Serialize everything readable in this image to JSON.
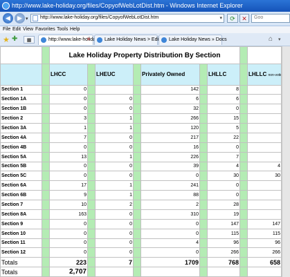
{
  "window": {
    "title": "http://www.lake-holiday.org/files/CopyofWebLotDist.htm - Windows Internet Explorer"
  },
  "address": {
    "url": "http://www.lake-holiday.org/files/CopyofWebLotDist.htm",
    "search_placeholder": "Goo"
  },
  "menu": {
    "items": [
      "File",
      "Edit",
      "View",
      "Favorites",
      "Tools",
      "Help"
    ]
  },
  "tabs": [
    {
      "label": "http://www.lake-holiday...",
      "active": true
    },
    {
      "label": "Lake Holiday News > Edit — ...",
      "active": false
    },
    {
      "label": "Lake Holiday News » Docs",
      "active": false
    }
  ],
  "sheet": {
    "title": "Lake Holiday Property Distribution By Section",
    "headers": {
      "lhcc": "LHCC",
      "lheuc": "LHEUC",
      "private": "Privately Owned",
      "lhllc": "LHLLC",
      "lhllc2": "LHLLC",
      "lhllc2_note": "non-voting"
    },
    "rows": [
      [
        "Section 1",
        "0",
        "",
        "142",
        "8",
        ""
      ],
      [
        "Section 1A",
        "0",
        "0",
        "6",
        "6",
        ""
      ],
      [
        "Section 1B",
        "0",
        "0",
        "32",
        "0",
        ""
      ],
      [
        "Section 2",
        "3",
        "1",
        "266",
        "15",
        ""
      ],
      [
        "Section 3A",
        "1",
        "1",
        "120",
        "5",
        ""
      ],
      [
        "Section 4A",
        "7",
        "0",
        "217",
        "22",
        ""
      ],
      [
        "Section 4B",
        "0",
        "0",
        "16",
        "0",
        ""
      ],
      [
        "Section 5A",
        "13",
        "1",
        "226",
        "7",
        ""
      ],
      [
        "Section 5B",
        "0",
        "0",
        "39",
        "4",
        "4"
      ],
      [
        "Section 5C",
        "0",
        "0",
        "0",
        "30",
        "30"
      ],
      [
        "Section 6A",
        "17",
        "1",
        "241",
        "0",
        ""
      ],
      [
        "Section 6B",
        "9",
        "1",
        "88",
        "0",
        ""
      ],
      [
        "Section 7",
        "10",
        "2",
        "2",
        "28",
        ""
      ],
      [
        "Section 8A",
        "163",
        "0",
        "310",
        "19",
        ""
      ],
      [
        "Section 9",
        "0",
        "0",
        "0",
        "147",
        "147"
      ],
      [
        "Section 10",
        "0",
        "0",
        "0",
        "115",
        "115"
      ],
      [
        "Section 11",
        "0",
        "0",
        "4",
        "96",
        "96"
      ],
      [
        "Section 12",
        "0",
        "0",
        "0",
        "266",
        "266"
      ]
    ],
    "totals_label": "Totals",
    "totals": [
      "223",
      "7",
      "1709",
      "768",
      "658"
    ],
    "grand_totals_label": "Totals",
    "grand_total": "2,707"
  }
}
